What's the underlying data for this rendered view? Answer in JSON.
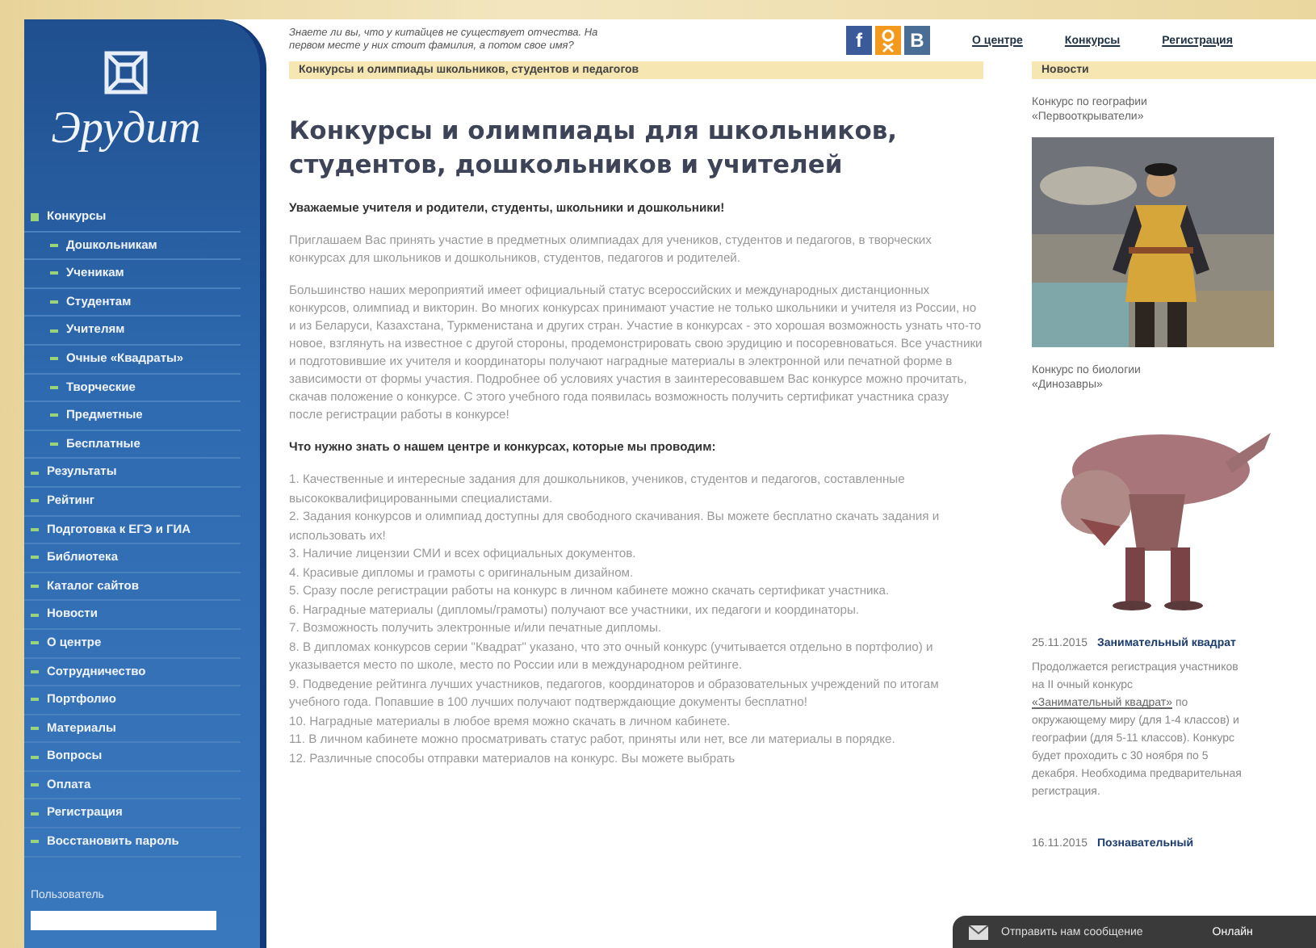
{
  "site": {
    "logo_text": "Эрудит",
    "tagline": "Знаете ли вы, что у китайцев не существует отчества. На первом месте у них стоит фамилия, а потом свое имя?",
    "social": [
      {
        "kind": "facebook",
        "label": "f"
      },
      {
        "kind": "odnoklassniki"
      },
      {
        "kind": "vk",
        "label": "В"
      }
    ],
    "top_links": [
      "О центре",
      "Конкурсы",
      "Регистрация"
    ],
    "breadcrumb": "Конкурсы и олимпиады школьников, студентов и педагогов",
    "nav": [
      {
        "label": "Конкурсы",
        "expanded": true,
        "children": [
          {
            "label": "Дошкольникам"
          },
          {
            "label": "Ученикам"
          },
          {
            "label": "Студентам"
          },
          {
            "label": "Учителям"
          },
          {
            "label": "Очные «Квадраты»"
          },
          {
            "label": "Творческие"
          },
          {
            "label": "Предметные"
          },
          {
            "label": "Бесплатные"
          }
        ]
      },
      {
        "label": "Результаты",
        "expanded": false
      },
      {
        "label": "Рейтинг",
        "expanded": false
      },
      {
        "label": "Подготовка к ЕГЭ и ГИА",
        "expanded": false
      },
      {
        "label": "Библиотека",
        "expanded": false
      },
      {
        "label": "Каталог сайтов",
        "expanded": false
      },
      {
        "label": "Новости",
        "expanded": false
      },
      {
        "label": "О центре",
        "expanded": false
      },
      {
        "label": "Сотрудничество",
        "expanded": false
      },
      {
        "label": "Портфолио",
        "expanded": false
      },
      {
        "label": "Материалы",
        "expanded": false
      },
      {
        "label": "Вопросы",
        "expanded": false
      },
      {
        "label": "Оплата",
        "expanded": false
      },
      {
        "label": "Регистрация",
        "expanded": false
      },
      {
        "label": "Восстановить пароль",
        "expanded": false
      }
    ],
    "user_label": "Пользователь",
    "main": {
      "heading": "Конкурсы и олимпиады для школьников, студентов, дошкольников и учителей",
      "greeting": "Уважаемые учителя и родители, студенты, школьники и дошкольники!",
      "paragraphs": [
        "Приглашаем Вас принять участие в предметных олимпиадах для учеников, студентов и педагогов, в творческих конкурсах для школьников и дошкольников, студентов, педагогов и родителей.",
        "Большинство наших мероприятий имеет официальный статус всероссийских и международных дистанционных конкурсов, олимпиад и викторин. Во многих конкурсах принимают участие не только школьники и учителя из России, но и из Беларуси, Казахстана, Туркменистана и других стран. Участие в конкурсах - это хорошая возможность узнать что-то новое, взглянуть на известное с другой стороны, продемонстрировать свою эрудицию и посоревноваться. Все участники и подготовившие их учителя и координаторы получают наградные материалы в электронной или печатной форме в зависимости от формы участия. Подробнее об условиях участия в заинтересовавшем Вас конкурсе можно прочитать, скачав положение о конкурсе. С этого учебного года появилась возможность получить сертификат участника сразу после регистрации работы в конкурсе!"
      ],
      "question": "Что нужно знать о нашем центре и конкурсах, которые мы проводим:",
      "points": [
        "1. Качественные и интересные задания для дошкольников, учеников, студентов и педагогов, составленные высококвалифицированными специалистами.",
        "2. Задания конкурсов и олимпиад доступны для свободного скачивания. Вы можете бесплатно скачать задания и использовать их!",
        "3. Наличие лицензии СМИ и всех официальных документов.",
        "4. Красивые дипломы и грамоты с оригинальным дизайном.",
        "5. Сразу после регистрации работы на конкурс в личном кабинете можно скачать сертификат участника.",
        "6. Наградные материалы (дипломы/грамоты) получают все участники, их педагоги и координаторы.",
        "7. Возможность получить электронные и/или печатные дипломы.",
        "8. В дипломах конкурсов серии \"Квадрат\" указано, что это очный конкурс (учитывается отдельно в портфолио) и указывается место по школе, место по России или в международном рейтинге.",
        "9. Подведение рейтинга лучших участников, педагогов, координаторов и образовательных учреждений по итогам учебного года. Попавшие в 100 лучших получают подтверждающие документы бесплатно!",
        "10. Наградные материалы в любое время можно скачать в личном кабинете.",
        "11. В личном кабинете можно просматривать статус работ, приняты или нет, все ли материалы в порядке.",
        "12. Различные способы отправки материалов на конкурс. Вы можете выбрать"
      ]
    },
    "news": {
      "title": "Новости",
      "features": [
        {
          "caption": "Конкурс по географии «Первооткрыватели»",
          "kind": "picture"
        },
        {
          "caption": "Конкурс по биологии «Динозавры»",
          "kind": "picture"
        }
      ],
      "items": [
        {
          "date": "25.11.2015",
          "title": "Занимательный квадрат",
          "text_before": "Продолжается регистрация участников на II очный конкурс ",
          "link": "«Занимательный квадрат»",
          "text_after": " по окружающему миру (для 1-4 классов) и географии (для 5-11 классов). Конкурс будет проходить с 30 ноября по 5 декабря. Необходима предварительная регистрация."
        },
        {
          "date": "16.11.2015",
          "title": "Познавательный"
        }
      ]
    },
    "chat": {
      "label": "Отправить нам сообщение",
      "status": "Онлайн"
    }
  }
}
